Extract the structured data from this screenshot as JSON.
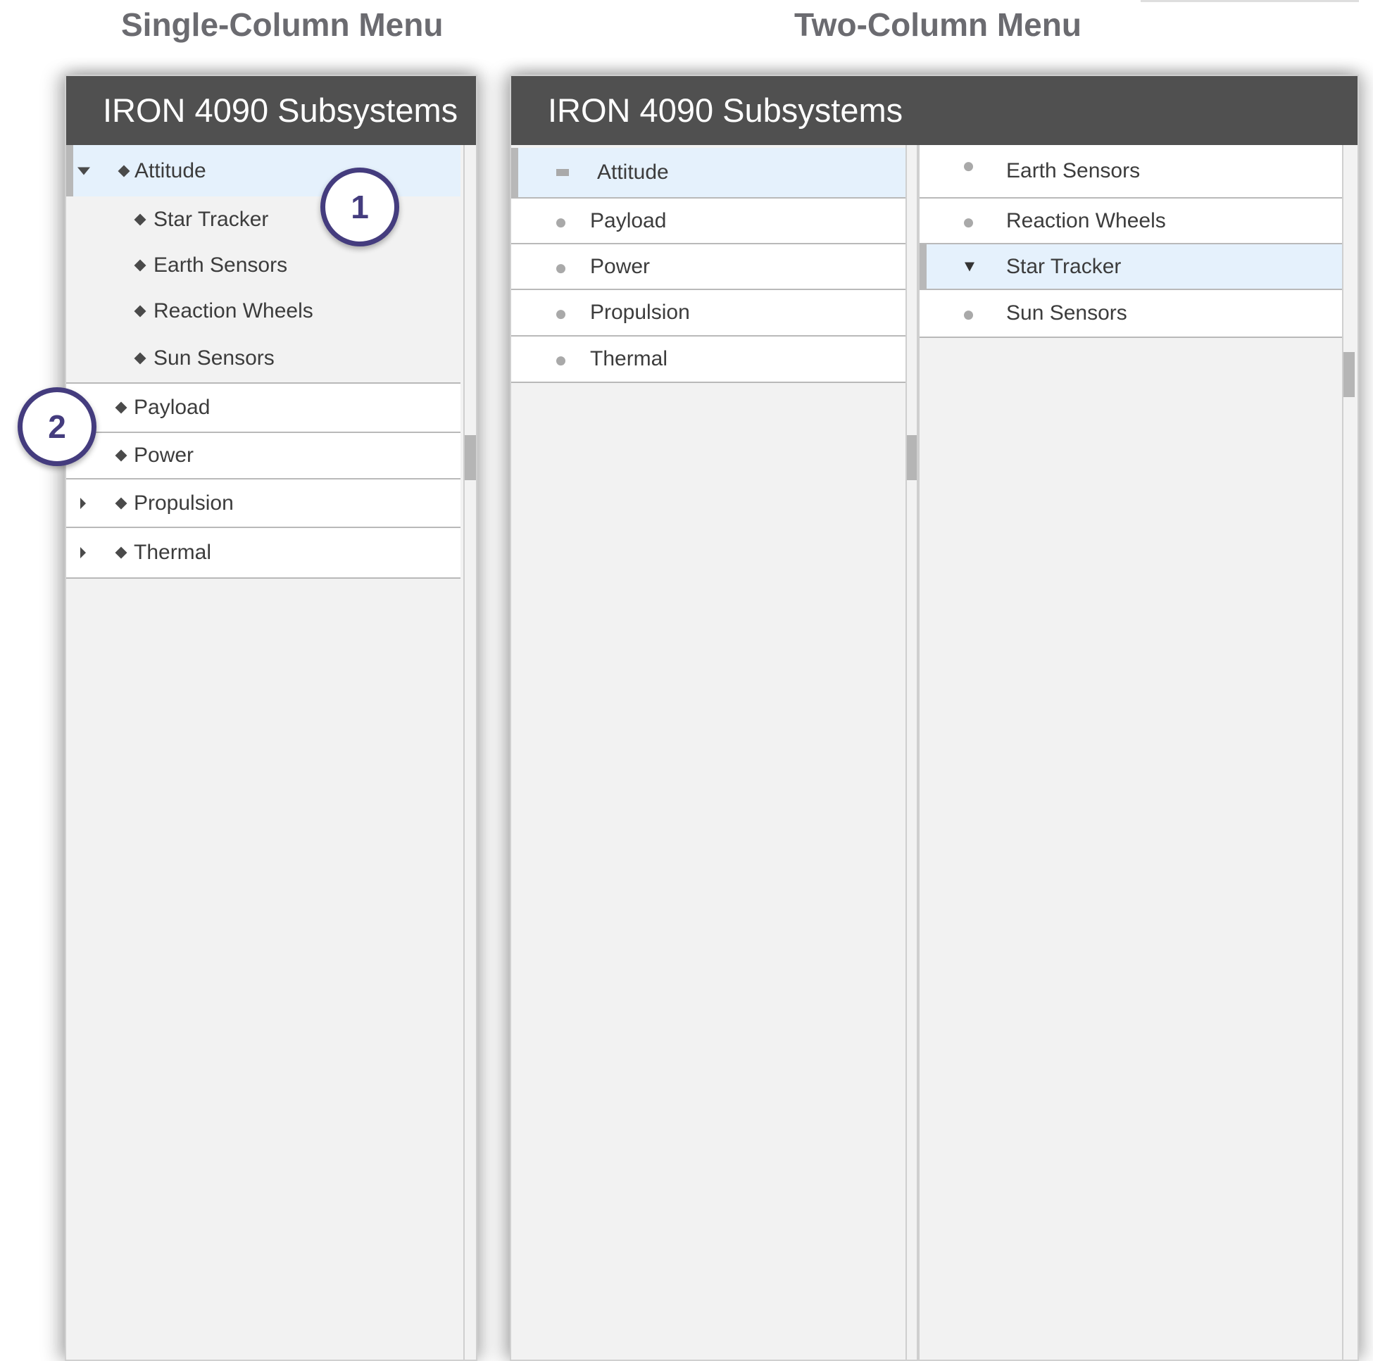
{
  "captions": {
    "single": "Single-Column Menu",
    "two": "Two-Column Menu"
  },
  "single_menu": {
    "title": "IRON 4090 Subsystems",
    "items": [
      {
        "label": "Attitude",
        "state": "expanded",
        "selected": true
      },
      {
        "label": "Star Tracker",
        "child": true
      },
      {
        "label": "Earth Sensors",
        "child": true
      },
      {
        "label": "Reaction Wheels",
        "child": true
      },
      {
        "label": "Sun Sensors",
        "child": true
      },
      {
        "label": "Payload"
      },
      {
        "label": "Power"
      },
      {
        "label": "Propulsion",
        "state": "collapsed"
      },
      {
        "label": "Thermal",
        "state": "collapsed"
      }
    ]
  },
  "two_menu": {
    "title": "IRON 4090 Subsystems",
    "left_items": [
      {
        "label": "Attitude",
        "selected": true
      },
      {
        "label": "Payload"
      },
      {
        "label": "Power"
      },
      {
        "label": "Propulsion"
      },
      {
        "label": "Thermal"
      }
    ],
    "right_items": [
      {
        "label": "Earth Sensors"
      },
      {
        "label": "Reaction Wheels"
      },
      {
        "label": "Star Tracker",
        "selected": true
      },
      {
        "label": "Sun Sensors"
      }
    ]
  },
  "callouts": [
    "1",
    "2"
  ],
  "colors": {
    "header_bg": "#505050",
    "selected_bg": "#e5f1fc",
    "callout": "#443c7e",
    "panel_bg": "#f2f2f2"
  }
}
